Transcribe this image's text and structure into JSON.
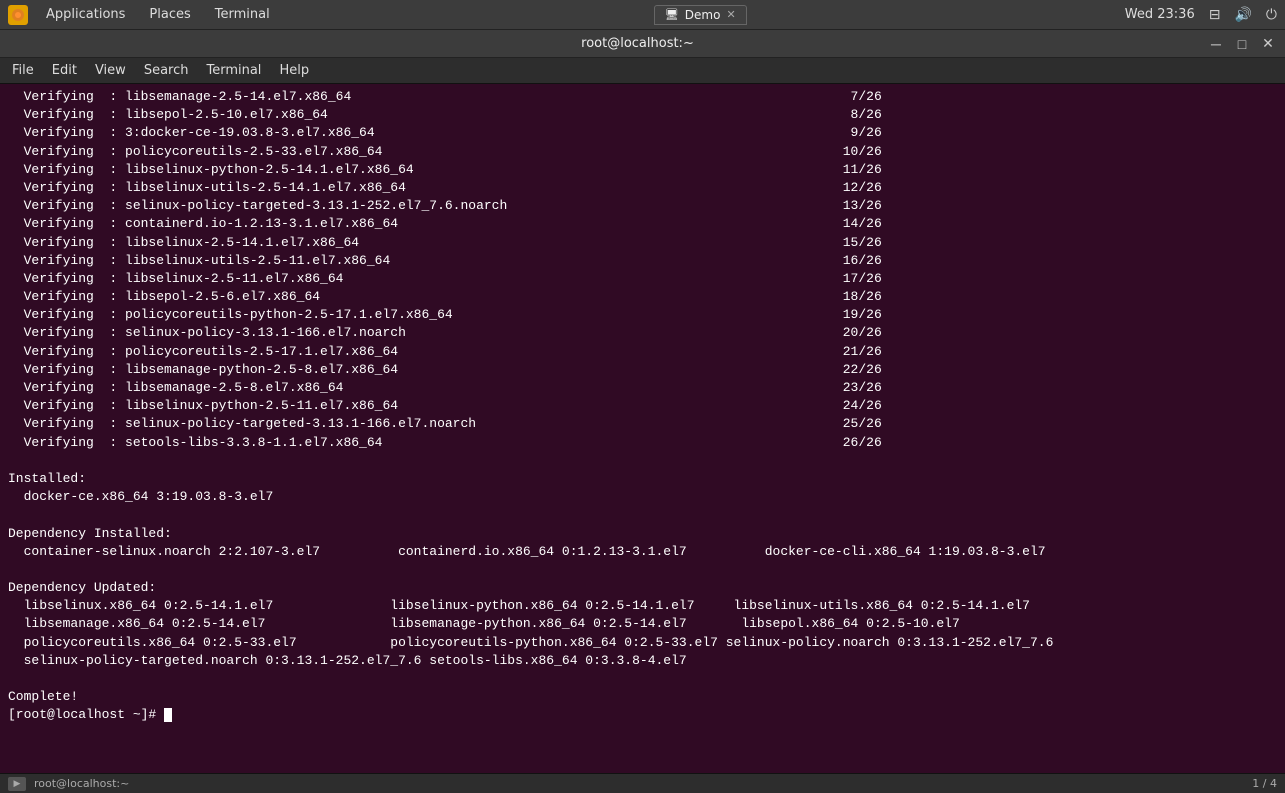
{
  "taskbar": {
    "app_label": "Applications",
    "places_label": "Places",
    "terminal_label": "Terminal",
    "time": "Wed 23:36",
    "tab_label": "Demo",
    "tab_icon": "🖥"
  },
  "terminal": {
    "title": "root@localhost:~",
    "menu": {
      "file": "File",
      "edit": "Edit",
      "view": "View",
      "search": "Search",
      "terminal": "Terminal",
      "help": "Help"
    },
    "lines": [
      "  Verifying  : libsemanage-2.5-14.el7.x86_64                                                                7/26",
      "  Verifying  : libsepol-2.5-10.el7.x86_64                                                                   8/26",
      "  Verifying  : 3:docker-ce-19.03.8-3.el7.x86_64                                                             9/26",
      "  Verifying  : policycoreutils-2.5-33.el7.x86_64                                                           10/26",
      "  Verifying  : libselinux-python-2.5-14.1.el7.x86_64                                                       11/26",
      "  Verifying  : libselinux-utils-2.5-14.1.el7.x86_64                                                        12/26",
      "  Verifying  : selinux-policy-targeted-3.13.1-252.el7_7.6.noarch                                           13/26",
      "  Verifying  : containerd.io-1.2.13-3.1.el7.x86_64                                                         14/26",
      "  Verifying  : libselinux-2.5-14.1.el7.x86_64                                                              15/26",
      "  Verifying  : libselinux-utils-2.5-11.el7.x86_64                                                          16/26",
      "  Verifying  : libselinux-2.5-11.el7.x86_64                                                                17/26",
      "  Verifying  : libsepol-2.5-6.el7.x86_64                                                                   18/26",
      "  Verifying  : policycoreutils-python-2.5-17.1.el7.x86_64                                                  19/26",
      "  Verifying  : selinux-policy-3.13.1-166.el7.noarch                                                        20/26",
      "  Verifying  : policycoreutils-2.5-17.1.el7.x86_64                                                         21/26",
      "  Verifying  : libsemanage-python-2.5-8.el7.x86_64                                                         22/26",
      "  Verifying  : libsemanage-2.5-8.el7.x86_64                                                                23/26",
      "  Verifying  : libselinux-python-2.5-11.el7.x86_64                                                         24/26",
      "  Verifying  : selinux-policy-targeted-3.13.1-166.el7.noarch                                               25/26",
      "  Verifying  : setools-libs-3.3.8-1.1.el7.x86_64                                                           26/26",
      "",
      "Installed:",
      "  docker-ce.x86_64 3:19.03.8-3.el7",
      "",
      "Dependency Installed:",
      "  container-selinux.noarch 2:2.107-3.el7          containerd.io.x86_64 0:1.2.13-3.1.el7          docker-ce-cli.x86_64 1:19.03.8-3.el7",
      "",
      "Dependency Updated:",
      "  libselinux.x86_64 0:2.5-14.1.el7               libselinux-python.x86_64 0:2.5-14.1.el7     libselinux-utils.x86_64 0:2.5-14.1.el7",
      "  libsemanage.x86_64 0:2.5-14.el7                libsemanage-python.x86_64 0:2.5-14.el7       libsepol.x86_64 0:2.5-10.el7",
      "  policycoreutils.x86_64 0:2.5-33.el7            policycoreutils-python.x86_64 0:2.5-33.el7 selinux-policy.noarch 0:3.13.1-252.el7_7.6",
      "  selinux-policy-targeted.noarch 0:3.13.1-252.el7_7.6 setools-libs.x86_64 0:3.3.8-4.el7",
      "",
      "Complete!",
      "[root@localhost ~]# "
    ],
    "prompt": "[root@localhost ~]# "
  },
  "statusbar": {
    "left_text": "root@localhost:~",
    "right_text": "1 / 4"
  }
}
